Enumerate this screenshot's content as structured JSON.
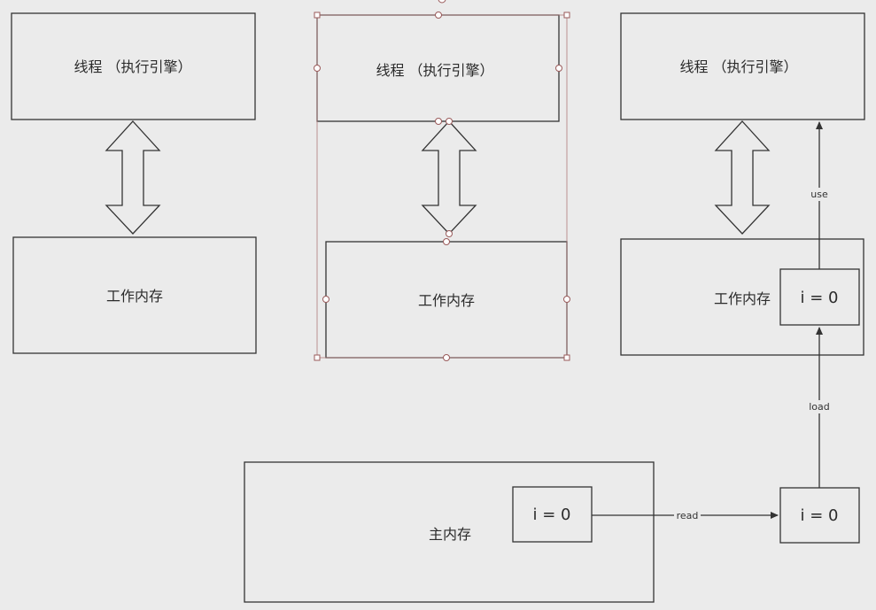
{
  "nodes": {
    "thread1": {
      "label": "线程 （执行引擎）"
    },
    "thread2": {
      "label": "线程 （执行引擎）"
    },
    "thread3": {
      "label": "线程 （执行引擎）"
    },
    "working1": {
      "label": "工作内存"
    },
    "working2": {
      "label": "工作内存"
    },
    "working3": {
      "label": "工作内存"
    },
    "main_memory": {
      "label": "主内存"
    },
    "var_main": {
      "label": "i = 0"
    },
    "var_read": {
      "label": "i = 0"
    },
    "var_working": {
      "label": "i = 0"
    }
  },
  "edges": {
    "read": {
      "label": "read"
    },
    "load": {
      "label": "load"
    },
    "use": {
      "label": "use"
    }
  },
  "colors": {
    "background": "#ebebeb",
    "stroke": "#333333",
    "selection": "#b07a7a",
    "handle_fill": "#ffffff"
  }
}
